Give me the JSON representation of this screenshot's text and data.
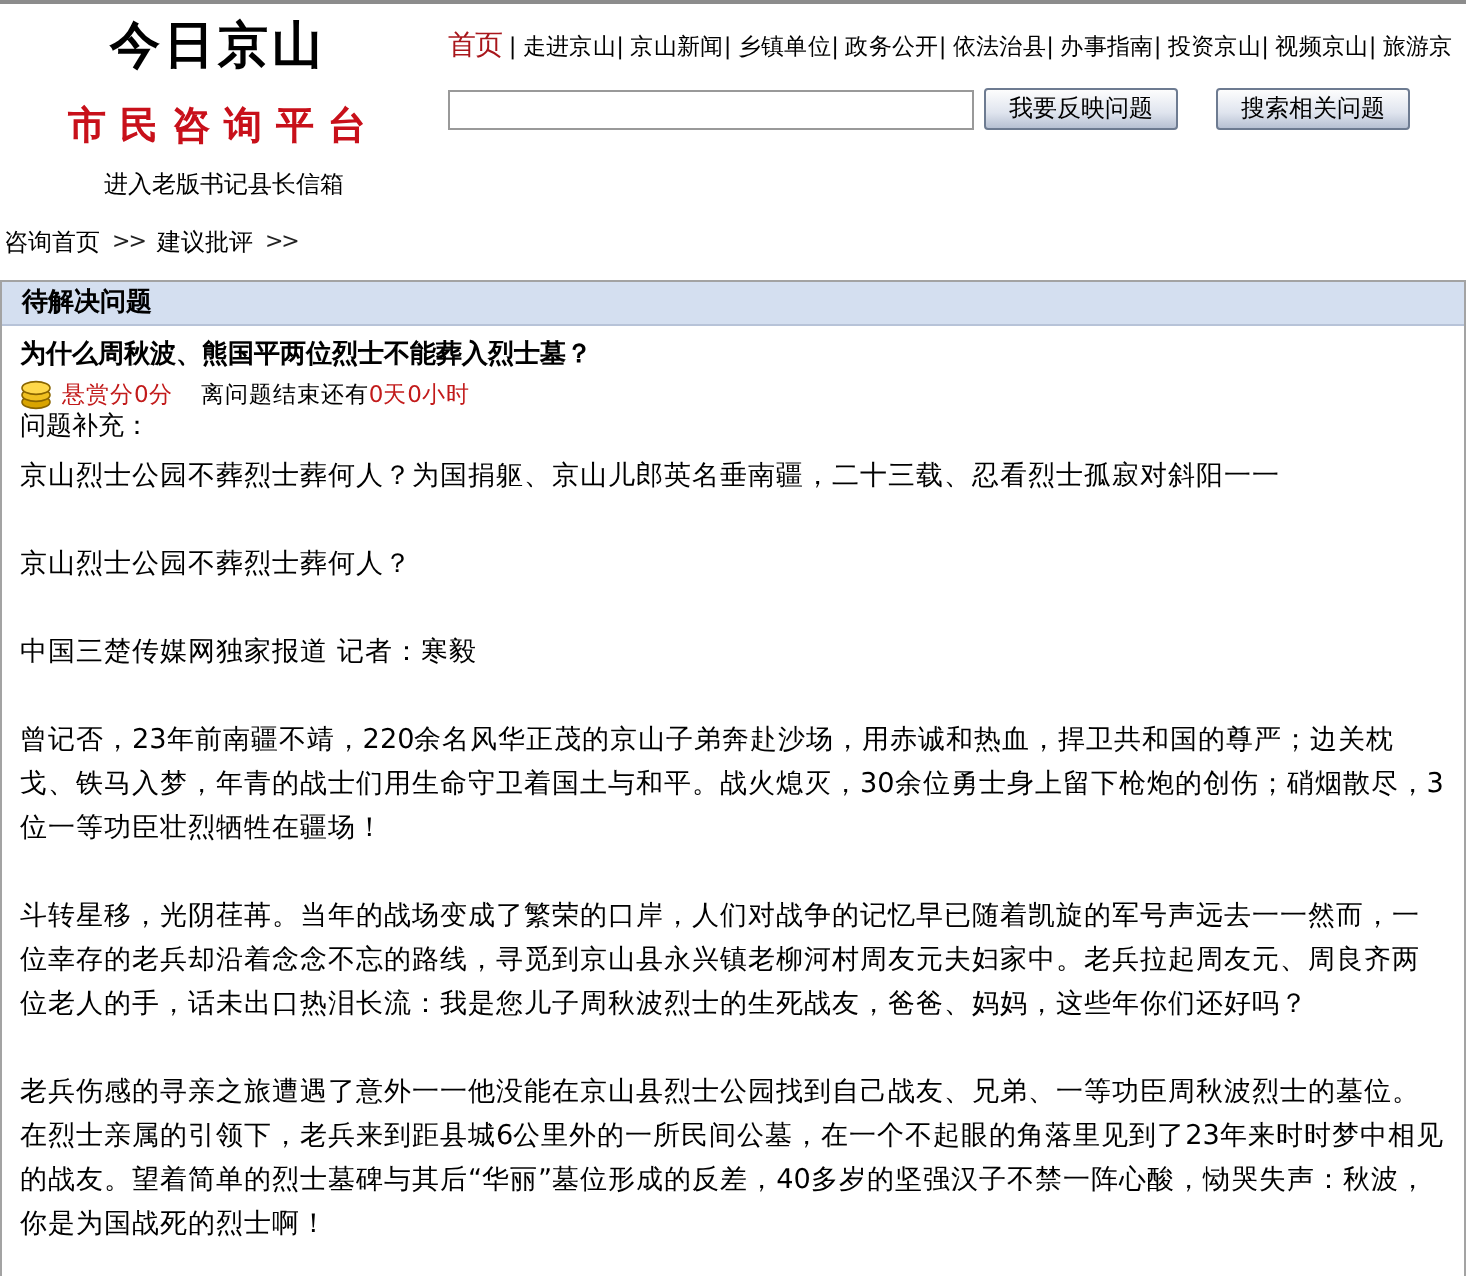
{
  "logo": {
    "title": "今日京山",
    "subtitle": "市民咨询平台",
    "old_mailbox_link": "进入老版书记县长信箱"
  },
  "nav": [
    {
      "label": "首页",
      "selected": true
    },
    {
      "separator": "|",
      "label": "走进京山",
      "selected": false
    },
    {
      "separator": "|",
      "label": "京山新闻",
      "selected": false
    },
    {
      "separator": "|",
      "label": "乡镇单位",
      "selected": false
    },
    {
      "separator": "|",
      "label": "政务公开",
      "selected": false
    },
    {
      "separator": "|",
      "label": "依法治县",
      "selected": false
    },
    {
      "separator": "|",
      "label": "办事指南",
      "selected": false
    },
    {
      "separator": "|",
      "label": "投资京山",
      "selected": false
    },
    {
      "separator": "|",
      "label": "视频京山",
      "selected": false
    },
    {
      "separator": "|",
      "label": "旅游京",
      "selected": false
    }
  ],
  "search": {
    "buttons": [
      "我要反映问题",
      "搜索相关问题"
    ]
  },
  "breadcrumb": [
    {
      "kind": "link",
      "text": "咨询首页"
    },
    {
      "kind": "separator",
      "text": ">>"
    },
    {
      "kind": "link",
      "text": "建议批评"
    },
    {
      "kind": "separator",
      "text": ">>"
    }
  ],
  "panel": {
    "heading": "待解决问题",
    "question": {
      "title": "为什么周秋波、熊国平两位烈士不能葬入烈士墓？",
      "reward": "悬赏分0分",
      "remaining_label": "离问题结束还有",
      "remaining_value": "0天0小时",
      "supplement_label": "问题补充：",
      "paragraphs": [
        "京山烈士公园不葬烈士葬何人？为国捐躯、京山儿郎英名垂南疆，二十三载、忍看烈士孤寂对斜阳一一",
        "京山烈士公园不葬烈士葬何人？",
        "中国三楚传媒网独家报道 记者：寒毅",
        "曾记否，23年前南疆不靖，220余名风华正茂的京山子弟奔赴沙场，用赤诚和热血，捍卫共和国的尊严；边关枕戈、铁马入梦，年青的战士们用生命守卫着国土与和平。战火熄灭，30余位勇士身上留下枪炮的创伤；硝烟散尽，3位一等功臣壮烈牺牲在疆场！",
        "斗转星移，光阴荏苒。当年的战场变成了繁荣的口岸，人们对战争的记忆早已随着凯旋的军号声远去一一然而，一位幸存的老兵却沿着念念不忘的路线，寻觅到京山县永兴镇老柳河村周友元夫妇家中。老兵拉起周友元、周良齐两位老人的手，话未出口热泪长流：我是您儿子周秋波烈士的生死战友，爸爸、妈妈，这些年你们还好吗？",
        "老兵伤感的寻亲之旅遭遇了意外一一他没能在京山县烈士公园找到自己战友、兄弟、一等功臣周秋波烈士的墓位。在烈士亲属的引领下，老兵来到距县城6公里外的一所民间公墓，在一个不起眼的角落里见到了23年来时时梦中相见的战友。望着简单的烈士墓碑与其后“华丽”墓位形成的反差，40多岁的坚强汉子不禁一阵心酸，恸哭失声：秋波，你是为国战死的烈士啊！"
      ]
    }
  }
}
